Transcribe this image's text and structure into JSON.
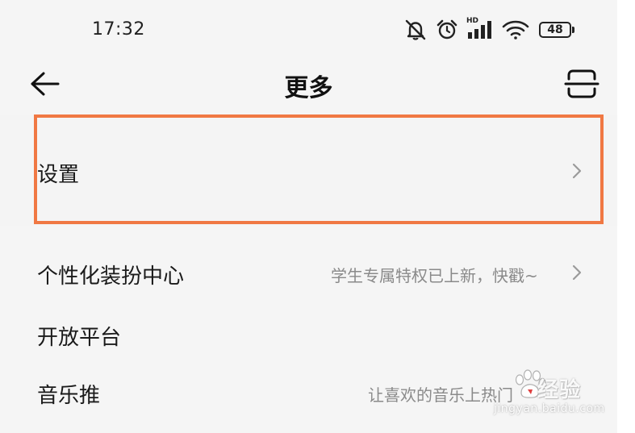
{
  "status_bar": {
    "time": "17:32",
    "network_label": "HD",
    "battery": "48",
    "icons": [
      "mute-bell-icon",
      "alarm-icon",
      "hd-signal-icon",
      "wifi-icon",
      "battery-icon"
    ]
  },
  "header": {
    "title": "更多",
    "back_icon": "arrow-left-icon",
    "scan_icon": "scan-icon"
  },
  "list": {
    "settings": {
      "label": "设置"
    },
    "theme": {
      "label": "个性化装扮中心",
      "hint": "学生专属特权已上新，快戳~"
    },
    "open_platform": {
      "label": "开放平台"
    },
    "music_push": {
      "label": "音乐推",
      "hint": "让喜欢的音乐上热门"
    }
  },
  "watermark": {
    "brand": "经验",
    "url": "jingyan.baidu.com"
  },
  "colors": {
    "background": "#f5f5f5",
    "highlight": "#f07843",
    "hint_text": "#8a8a8a"
  }
}
